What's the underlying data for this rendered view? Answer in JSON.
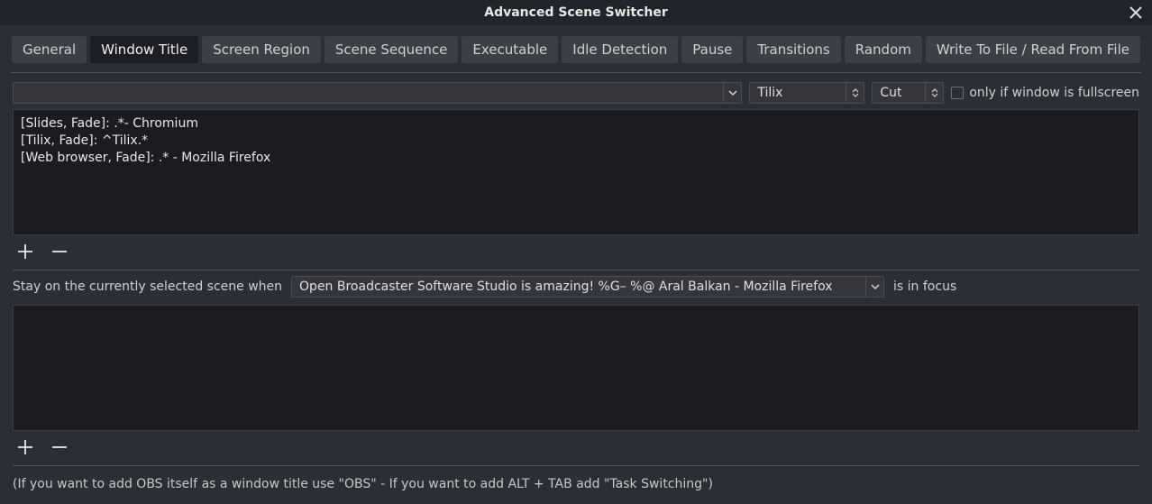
{
  "window": {
    "title": "Advanced Scene Switcher"
  },
  "tabs": {
    "items": [
      {
        "label": "General"
      },
      {
        "label": "Window Title"
      },
      {
        "label": "Screen Region"
      },
      {
        "label": "Scene Sequence"
      },
      {
        "label": "Executable"
      },
      {
        "label": "Idle Detection"
      },
      {
        "label": "Pause"
      },
      {
        "label": "Transitions"
      },
      {
        "label": "Random"
      },
      {
        "label": "Write To File / Read From File"
      }
    ],
    "active_index": 1
  },
  "controls": {
    "window_combo": "",
    "scene_combo": "Tilix",
    "transition_combo": "Cut",
    "fullscreen_label": "only if window is fullscreen"
  },
  "rules": [
    "[Slides, Fade]: .*- Chromium",
    "[Tilix, Fade]: ^Tilix.*",
    "[Web browser, Fade]: .* - Mozilla Firefox"
  ],
  "stay": {
    "prefix": "Stay on the currently selected scene when",
    "window": "Open Broadcaster Software Studio is amazing!  %G– %@ Aral Balkan - Mozilla Firefox",
    "suffix": "is in focus"
  },
  "hint": "(If you want to add OBS itself as a window title use \"OBS\" - If you want to add ALT + TAB add \"Task Switching\")"
}
